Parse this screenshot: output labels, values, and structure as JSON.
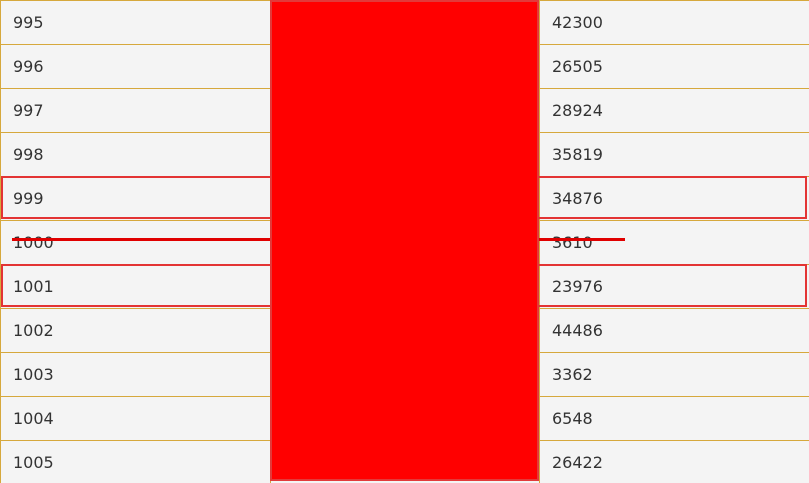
{
  "table": {
    "rows": [
      {
        "left": "995",
        "right": "42300"
      },
      {
        "left": "996",
        "right": "26505"
      },
      {
        "left": "997",
        "right": "28924"
      },
      {
        "left": "998",
        "right": "35819"
      },
      {
        "left": "999",
        "right": "34876"
      },
      {
        "left": "1000",
        "right": "3610"
      },
      {
        "left": "1001",
        "right": "23976"
      },
      {
        "left": "1002",
        "right": "44486"
      },
      {
        "left": "1003",
        "right": "3362"
      },
      {
        "left": "1004",
        "right": "6548"
      },
      {
        "left": "1005",
        "right": "26422"
      }
    ]
  },
  "colors": {
    "border": "#d6a83c",
    "cell_bg": "#f4f4f4",
    "text": "#333333",
    "highlight": "#e33434",
    "redaction": "#ff0000"
  }
}
